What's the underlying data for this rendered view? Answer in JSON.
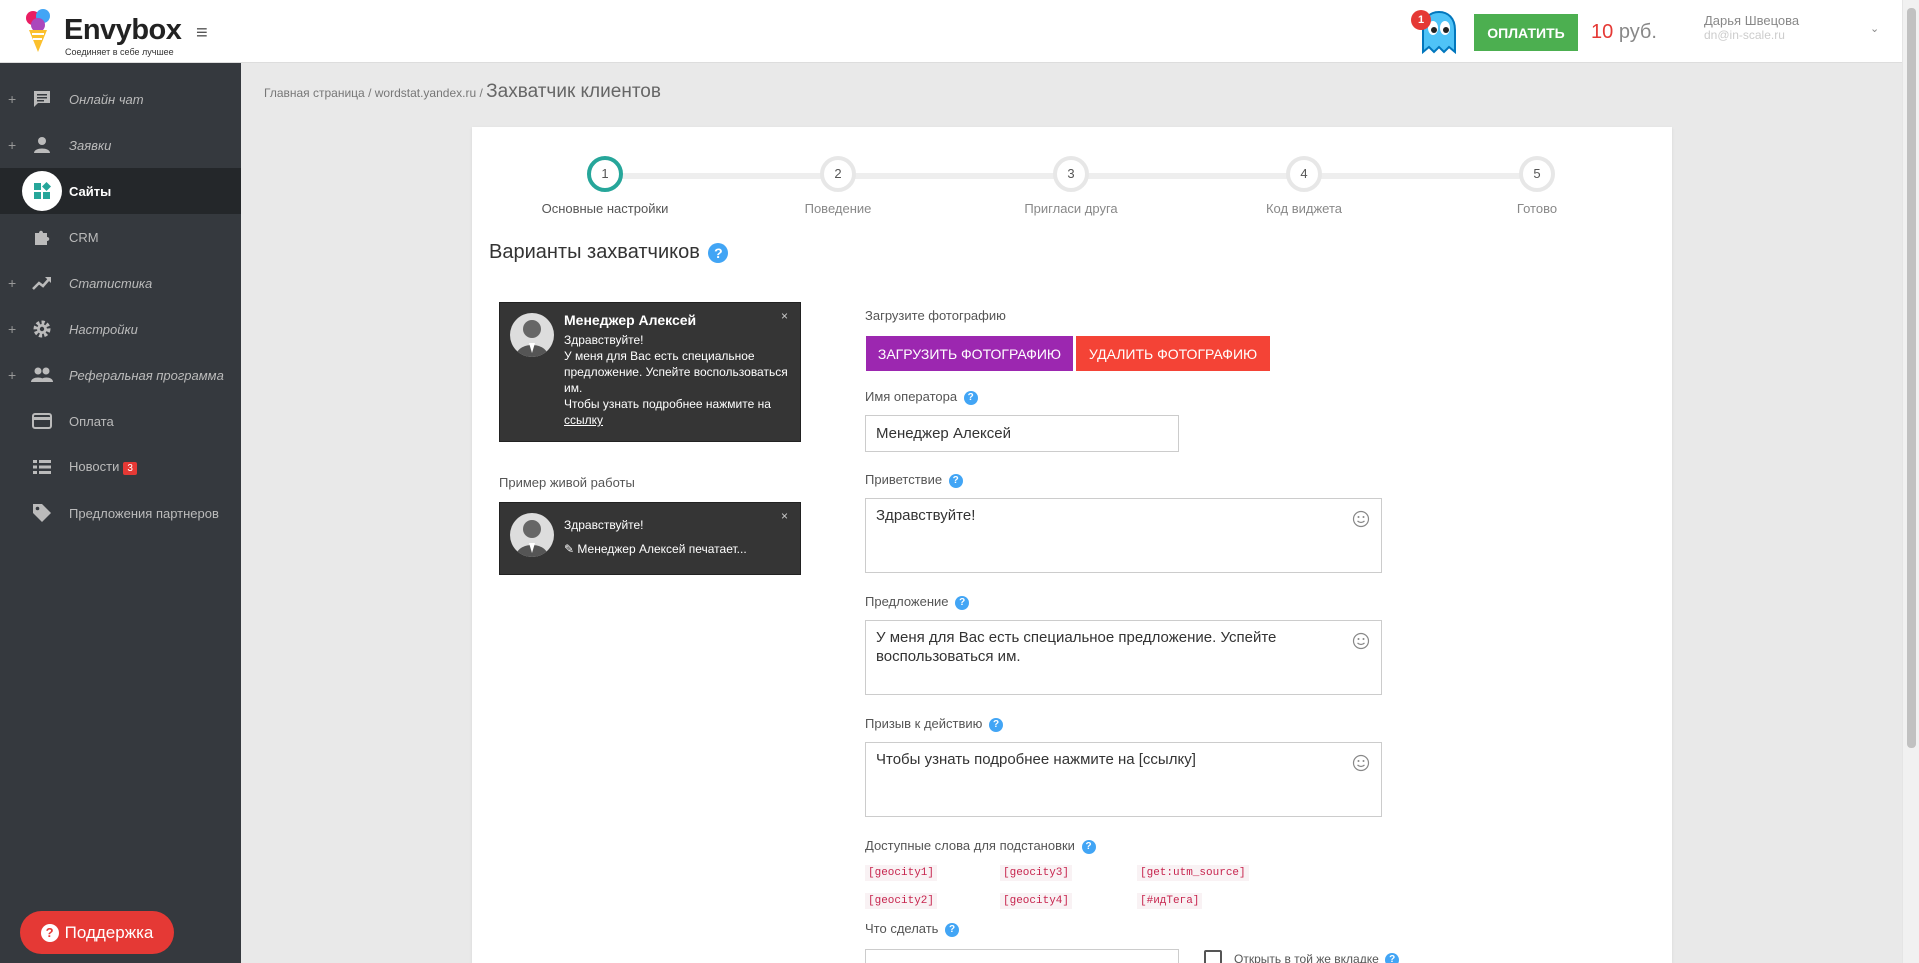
{
  "app": {
    "logo_text": "Envybox",
    "logo_tagline": "Соединяет в себе лучшее",
    "ghost_badge": "1",
    "pay_label": "ОПЛАТИТЬ",
    "balance_amount": "10",
    "balance_currency": "руб.",
    "user_name": "Дарья Швецова",
    "user_email": "dn@in-scale.ru"
  },
  "sidebar": {
    "items": [
      {
        "label": "Онлайн чат",
        "icon": "chat-icon"
      },
      {
        "label": "Заявки",
        "icon": "person-icon"
      },
      {
        "label": "Сайты",
        "icon": "widgets-icon"
      },
      {
        "label": "CRM",
        "icon": "puzzle-icon"
      },
      {
        "label": "Статистика",
        "icon": "trending-up-icon"
      },
      {
        "label": "Настройки",
        "icon": "gear-icon"
      },
      {
        "label": "Реферальная программа",
        "icon": "people-icon"
      },
      {
        "label": "Оплата",
        "icon": "credit-card-icon"
      },
      {
        "label": "Новости",
        "icon": "list-icon",
        "badge": "3"
      },
      {
        "label": "Предложения партнеров",
        "icon": "tag-icon"
      }
    ],
    "support_label": "Поддержка"
  },
  "breadcrumb": {
    "home": "Главная страница",
    "site": "wordstat.yandex.ru",
    "current": "Захватчик клиентов"
  },
  "stepper": {
    "steps": [
      {
        "num": "1",
        "label": "Основные настройки"
      },
      {
        "num": "2",
        "label": "Поведение"
      },
      {
        "num": "3",
        "label": "Пригласи друга"
      },
      {
        "num": "4",
        "label": "Код виджета"
      },
      {
        "num": "5",
        "label": "Готово"
      }
    ]
  },
  "section": {
    "title": "Варианты захватчиков"
  },
  "preview": {
    "manager_name": "Менеджер Алексей",
    "greeting": "Здравствуйте!",
    "offer": "У меня для Вас есть специальное предложение. Успейте воспользоваться им.",
    "cta_text": "Чтобы узнать подробнее нажмите на",
    "cta_link": "ссылку",
    "live_label": "Пример живой работы",
    "live_greeting": "Здравствуйте!",
    "live_typing": "Менеджер Алексей печатает..."
  },
  "form": {
    "photo_label": "Загрузите фотографию",
    "upload_label": "ЗАГРУЗИТЬ ФОТОГРАФИЮ",
    "delete_label": "УДАЛИТЬ ФОТОГРАФИЮ",
    "operator_label": "Имя оператора",
    "operator_value": "Менеджер Алексей",
    "greeting_label": "Приветствие",
    "greeting_value": "Здравствуйте!",
    "offer_label": "Предложение",
    "offer_value": "У меня для Вас есть специальное предложение. Успейте воспользоваться им.",
    "cta_label": "Призыв к действию",
    "cta_value": "Чтобы узнать подробнее нажмите на [ссылку]",
    "vars_label": "Доступные слова для подстановки",
    "vars": [
      "[geocity1]",
      "[geocity3]",
      "[get:utm_source]",
      "[geocity2]",
      "[geocity4]",
      "[#идТега]"
    ],
    "action_label": "Что сделать",
    "same_tab_label": "Открыть в той же вкладке"
  },
  "colors": {
    "sidebar_bg": "#35393e",
    "pay_green": "#4caf50",
    "upload_purple": "#9c27b0",
    "delete_red": "#f44336",
    "step_active": "#26a69a"
  }
}
